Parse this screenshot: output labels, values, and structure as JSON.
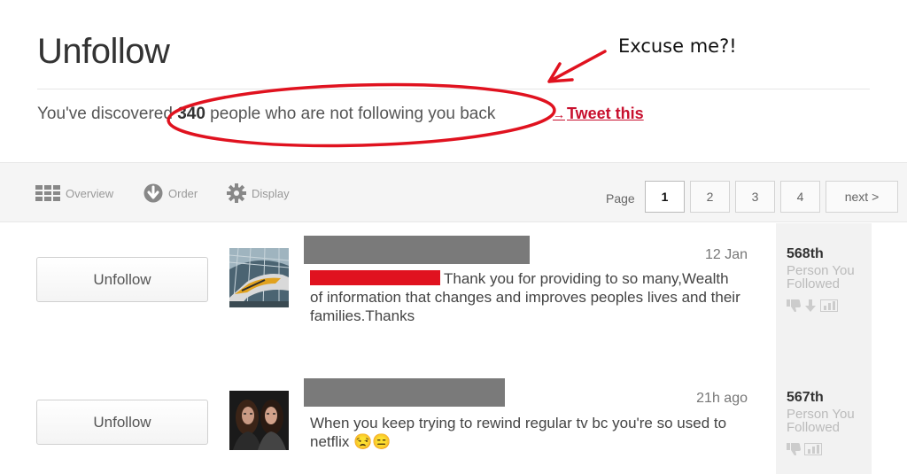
{
  "page": {
    "title": "Unfollow",
    "headline_prefix": "You've discovered ",
    "headline_count": "340",
    "headline_suffix": " people who are not following you back",
    "tweet_arrow": "→",
    "tweet_label": "Tweet this"
  },
  "annotation": {
    "text": "Excuse me?!",
    "color": "#e0121f"
  },
  "toolbar": {
    "overview": "Overview",
    "order": "Order",
    "display": "Display",
    "page_label": "Page",
    "pages": [
      "1",
      "2",
      "3",
      "4"
    ],
    "next": "next >",
    "current_page": "1"
  },
  "rows": [
    {
      "button": "Unfollow",
      "time": "12 Jan",
      "tweet": "Thank you for providing to so many,Wealth of information that changes and improves peoples lives and their families.Thanks",
      "rank": "568th",
      "rank_sub": "Person You Followed"
    },
    {
      "button": "Unfollow",
      "time": "21h ago",
      "tweet": "When you keep trying to rewind regular tv bc you're so used to netflix 😒😑",
      "rank": "567th",
      "rank_sub": "Person You Followed"
    }
  ],
  "icons": {
    "overview": "grid-icon",
    "order": "arrow-down-circle-icon",
    "display": "gear-icon",
    "thumbs_down": "thumbs-down-icon",
    "down_arrow": "down-arrow-icon",
    "stats": "bar-chart-icon"
  },
  "colors": {
    "accent": "#c8102e",
    "redaction_gray": "#7a7a7a",
    "redaction_red": "#e0121f"
  }
}
